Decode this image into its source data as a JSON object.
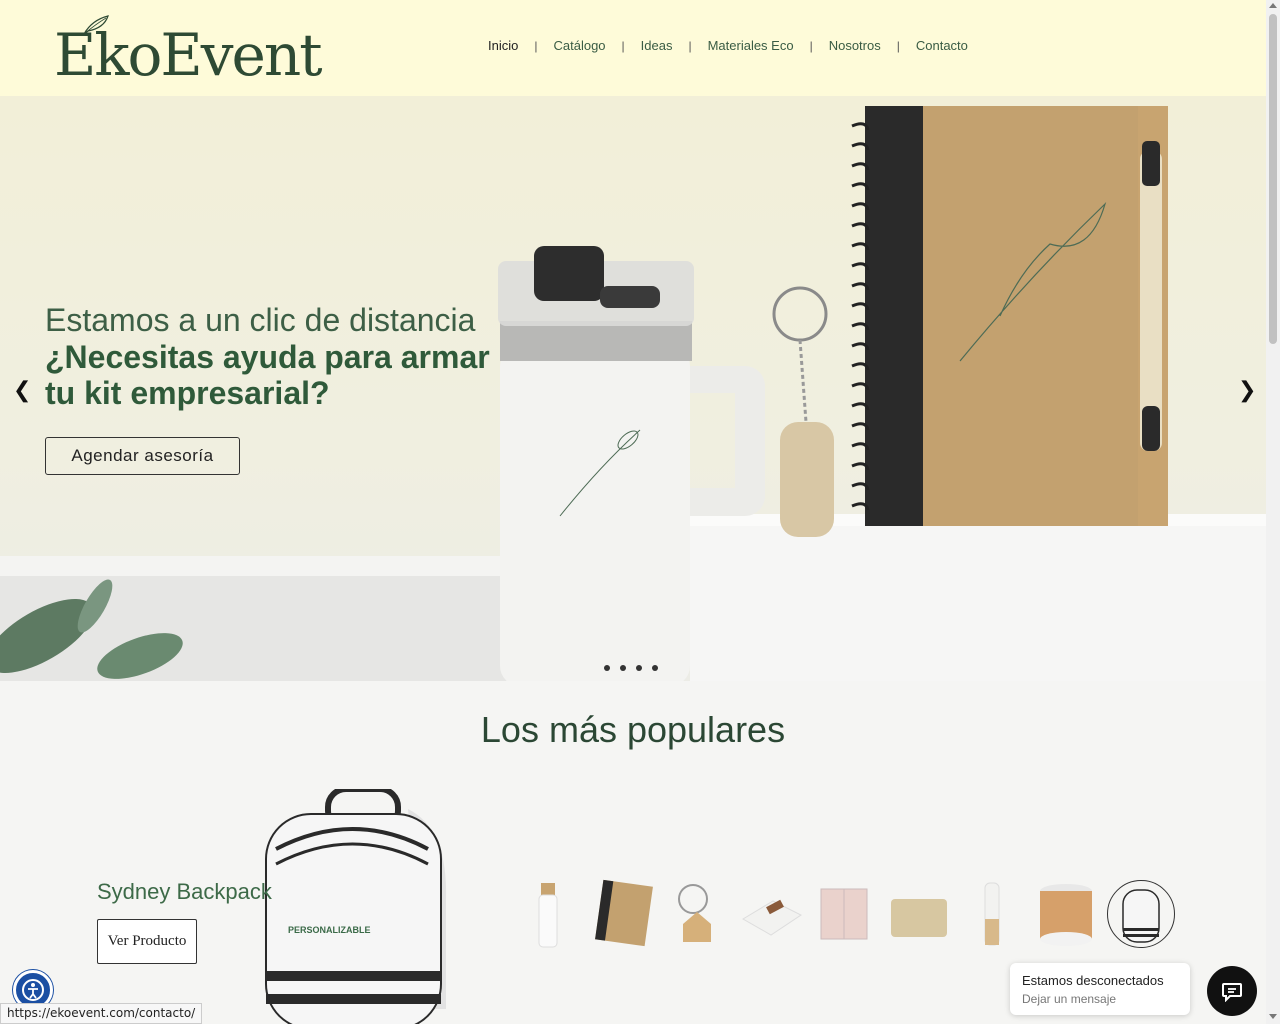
{
  "header": {
    "logo": "EkoEvent",
    "nav": [
      {
        "label": "Inicio",
        "active": true
      },
      {
        "label": "Catálogo",
        "active": false
      },
      {
        "label": "Ideas",
        "active": false
      },
      {
        "label": "Materiales Eco",
        "active": false
      },
      {
        "label": "Nosotros",
        "active": false
      },
      {
        "label": "Contacto",
        "active": false
      }
    ],
    "nav_separator": "|"
  },
  "hero": {
    "kicker": "Estamos a un clic de distancia",
    "title": "¿Necesitas ayuda para armar tu kit empresarial?",
    "cta": "Agendar asesoría",
    "slide_count": 4,
    "prev_icon": "chevron-left-icon",
    "next_icon": "chevron-right-icon"
  },
  "popular": {
    "title": "Los más populares",
    "product_name": "Sydney Backpack",
    "product_button": "Ver Producto",
    "backpack_print": "PERSONALIZABLE",
    "thumbnails": [
      "bottle",
      "notebook",
      "keychain",
      "towel",
      "cube",
      "pouch",
      "glass-bottle",
      "speaker",
      "backpack"
    ]
  },
  "chat": {
    "title": "Estamos desconectados",
    "subtitle": "Dejar un mensaje"
  },
  "status_url": "https://ekoevent.com/contacto/",
  "colors": {
    "brand_green": "#2e4a34",
    "header_bg": "#fefbd9"
  }
}
